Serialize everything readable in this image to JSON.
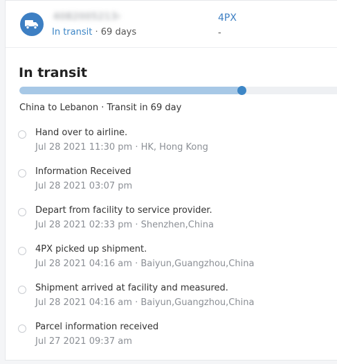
{
  "header": {
    "tracking_number": "4082005213450",
    "status_link": "In transit",
    "separator": "·",
    "days": "69 days",
    "carrier": "4PX",
    "carrier_sub": "-"
  },
  "main": {
    "title": "In transit",
    "progress_fraction": 0.68,
    "route": "China to Lebanon · Transit in 69 day"
  },
  "events": [
    {
      "title": "Hand over to airline.",
      "meta": "Jul 28 2021 11:30 pm · HK, Hong Kong"
    },
    {
      "title": "Information Received",
      "meta": "Jul 28 2021 03:07 pm"
    },
    {
      "title": "Depart from facility to service provider.",
      "meta": "Jul 28 2021 02:33 pm · Shenzhen,China"
    },
    {
      "title": "4PX picked up shipment.",
      "meta": "Jul 28 2021 04:16 am · Baiyun,Guangzhou,China"
    },
    {
      "title": "Shipment arrived at facility and measured.",
      "meta": "Jul 28 2021 04:16 am · Baiyun,Guangzhou,China"
    },
    {
      "title": "Parcel information received",
      "meta": "Jul 27 2021 09:37 am"
    }
  ],
  "colors": {
    "accent": "#3d86c6",
    "progress_fill": "#a7c8e6"
  },
  "icons": {
    "status": "truck-icon",
    "timeline": "circle-dot-icon"
  }
}
